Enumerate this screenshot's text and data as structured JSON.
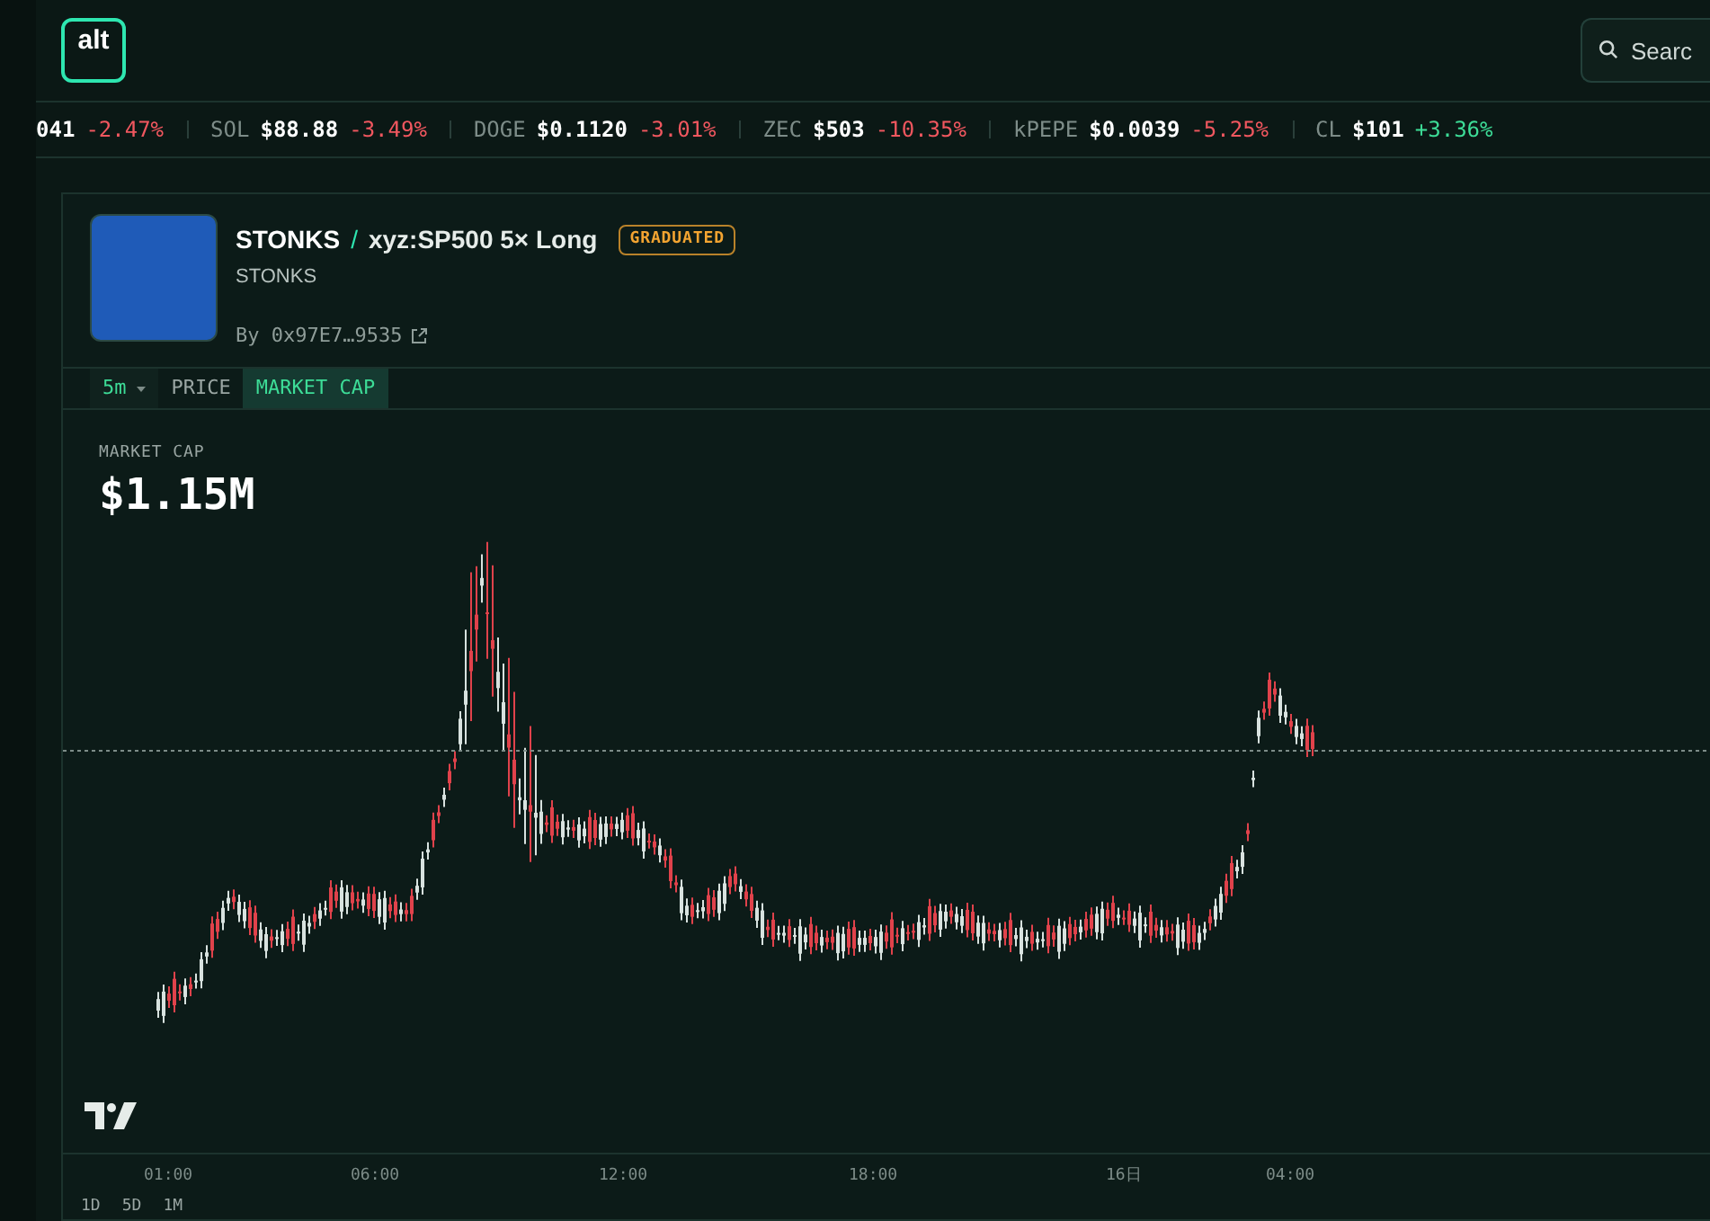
{
  "header": {
    "logo": "alt",
    "search": {
      "placeholder": "Searc"
    }
  },
  "ticker": [
    {
      "price": "041",
      "change": "-2.47%",
      "positive": false
    },
    {
      "symbol": "SOL",
      "price": "$88.88",
      "change": "-3.49%",
      "positive": false
    },
    {
      "symbol": "DOGE",
      "price": "$0.1120",
      "change": "-3.01%",
      "positive": false
    },
    {
      "symbol": "ZEC",
      "price": "$503",
      "change": "-10.35%",
      "positive": false
    },
    {
      "symbol": "kPEPE",
      "price": "$0.0039",
      "change": "-5.25%",
      "positive": false
    },
    {
      "symbol": "CL",
      "price": "$101",
      "change": "+3.36%",
      "positive": true
    }
  ],
  "token": {
    "name": "STONKS",
    "separator": "/",
    "pair": "xyz:SP500 5× Long",
    "badge": "GRADUATED",
    "subtitle": "STONKS",
    "creator": "By 0x97E7…9535"
  },
  "chart_tabs": [
    {
      "label": "5m",
      "kind": "dropdown",
      "selected": false
    },
    {
      "label": "PRICE",
      "kind": "tab",
      "selected": false
    },
    {
      "label": "MARKET CAP",
      "kind": "tab",
      "selected": true
    }
  ],
  "chart": {
    "label": "MARKET CAP",
    "value": "$1.15M",
    "x_labels": [
      "01:00",
      "06:00",
      "12:00",
      "18:00",
      "16日",
      "04:00"
    ]
  },
  "ranges": [
    "1D",
    "5D",
    "1M"
  ]
}
